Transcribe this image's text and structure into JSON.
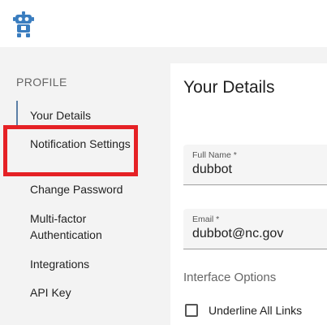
{
  "app": {
    "logo_icon": "robot-logo-icon"
  },
  "sidebar": {
    "section": "PROFILE",
    "items": [
      {
        "label": "Your Details"
      },
      {
        "label": "Notification Settings"
      },
      {
        "label": "Change Password"
      },
      {
        "label": "Multi-factor Authentication"
      },
      {
        "label": "Integrations"
      },
      {
        "label": "API Key"
      }
    ]
  },
  "main": {
    "title": "Your Details",
    "fields": [
      {
        "label": "Full Name *",
        "value": "dubbot"
      },
      {
        "label": "Email *",
        "value": "dubbot@nc.gov"
      }
    ],
    "interface_heading": "Interface Options",
    "checkbox_label": "Underline All Links",
    "checkbox_checked": false
  },
  "colors": {
    "accent": "#5b7fa6",
    "highlight": "#e52125",
    "logo": "#3a7dbf"
  }
}
